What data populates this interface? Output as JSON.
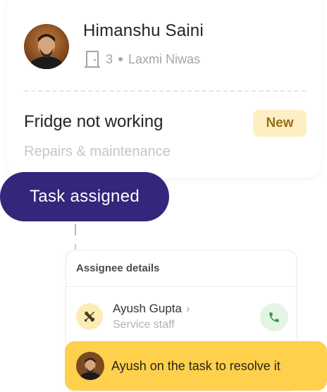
{
  "profile": {
    "name": "Himanshu Saini",
    "unit_number": "3",
    "building": "Laxmi Niwas"
  },
  "ticket": {
    "title": "Fridge not working",
    "status": "New",
    "category": "Repairs & maintenance"
  },
  "timeline": {
    "step_label": "Task assigned"
  },
  "assignee": {
    "header": "Assignee details",
    "name": "Ayush Gupta",
    "role": "Service staff"
  },
  "toast": {
    "message": "Ayush on the task to resolve it"
  },
  "colors": {
    "pill": "#34267a",
    "badge_bg": "#fdefc4",
    "badge_text": "#9a6e12",
    "toast_bg": "#fed04c",
    "call_bg": "#e3f4e5",
    "call_icon": "#2e9b43"
  },
  "icons": {
    "unit": "door-icon",
    "assignee": "tools-icon",
    "call": "phone-icon",
    "chevron": "chevron-right-icon"
  }
}
